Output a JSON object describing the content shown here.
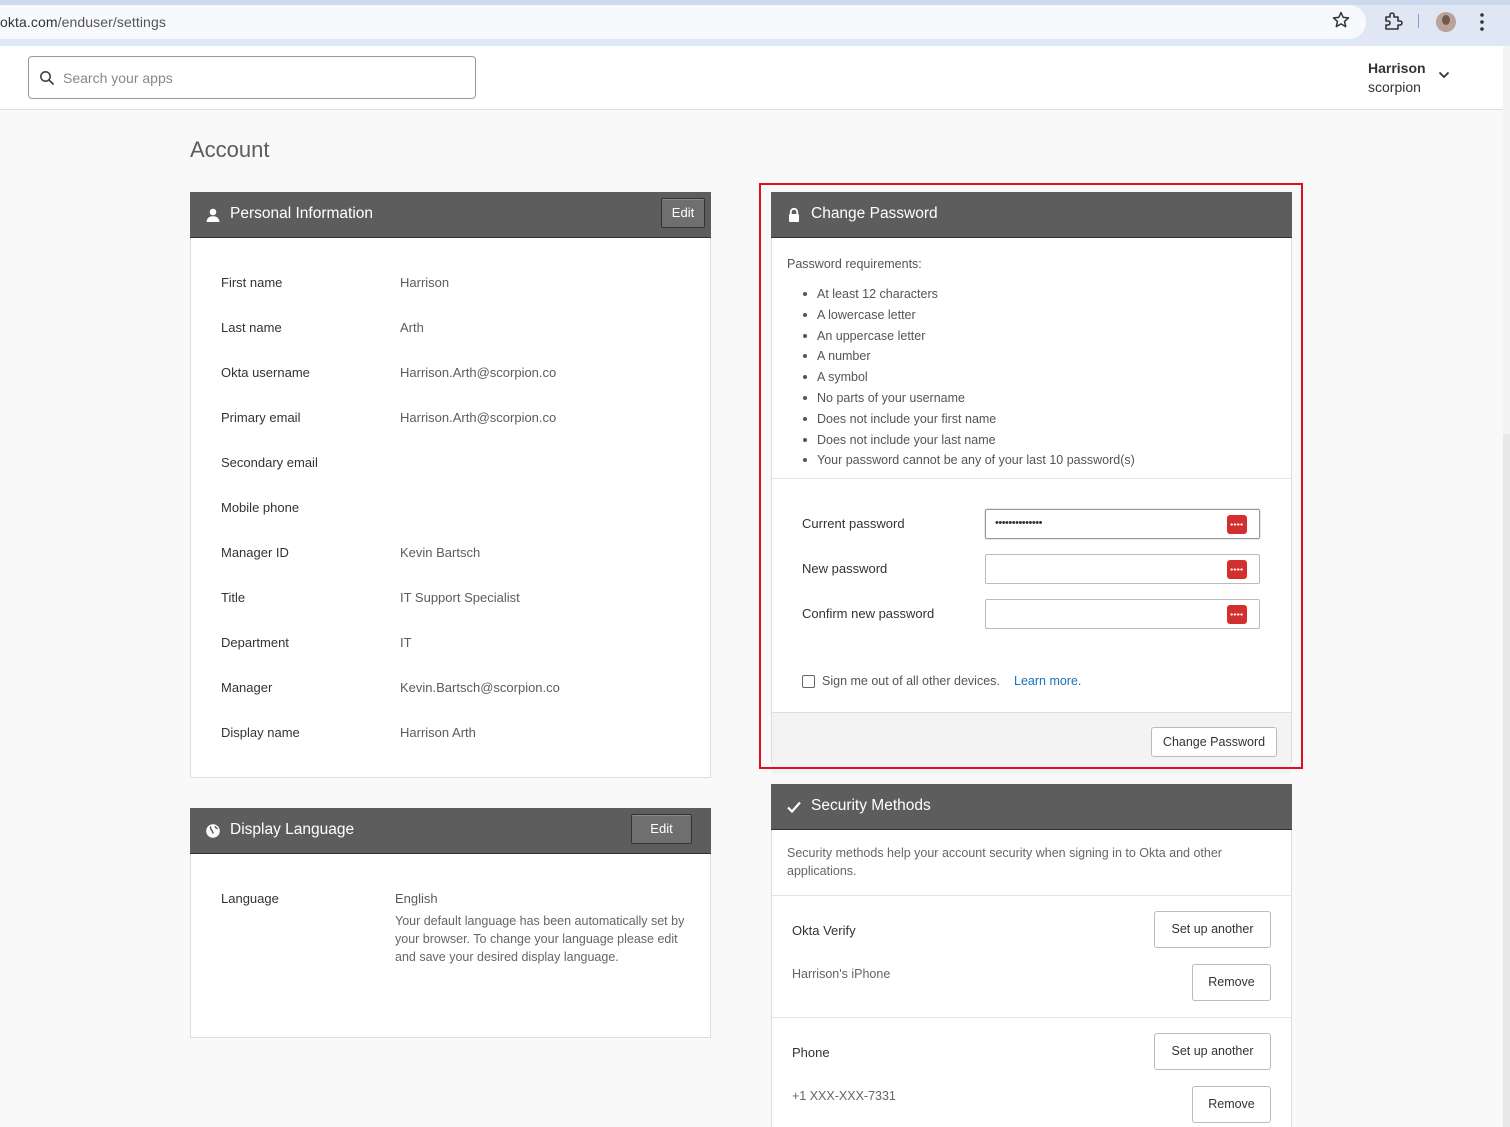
{
  "browser": {
    "url_domain": "okta.com",
    "url_path": "/enduser/settings"
  },
  "header": {
    "search_placeholder": "Search your apps",
    "user_name": "Harrison",
    "user_org": "scorpion"
  },
  "page": {
    "title": "Account"
  },
  "personal_info": {
    "title": "Personal Information",
    "edit_label": "Edit",
    "rows": [
      {
        "label": "First name",
        "value": "Harrison"
      },
      {
        "label": "Last name",
        "value": "Arth"
      },
      {
        "label": "Okta username",
        "value": "Harrison.Arth@scorpion.co"
      },
      {
        "label": "Primary email",
        "value": "Harrison.Arth@scorpion.co"
      },
      {
        "label": "Secondary email",
        "value": ""
      },
      {
        "label": "Mobile phone",
        "value": ""
      },
      {
        "label": "Manager ID",
        "value": "Kevin Bartsch"
      },
      {
        "label": "Title",
        "value": "IT Support Specialist"
      },
      {
        "label": "Department",
        "value": "IT"
      },
      {
        "label": "Manager",
        "value": "Kevin.Bartsch@scorpion.co"
      },
      {
        "label": "Display name",
        "value": "Harrison Arth"
      }
    ]
  },
  "display_language": {
    "title": "Display Language",
    "edit_label": "Edit",
    "language_label": "Language",
    "language_value": "English",
    "description": "Your default language has been automatically set by your browser. To change your language please edit and save your desired display language."
  },
  "change_password": {
    "title": "Change Password",
    "requirements_title": "Password requirements:",
    "requirements": [
      "At least 12 characters",
      "A lowercase letter",
      "An uppercase letter",
      "A number",
      "A symbol",
      "No parts of your username",
      "Does not include your first name",
      "Does not include your last name",
      "Your password cannot be any of your last 10 password(s)"
    ],
    "current_password_label": "Current password",
    "current_password_value": "••••••••••••••",
    "new_password_label": "New password",
    "confirm_password_label": "Confirm new password",
    "sign_out_label": "Sign me out of all other devices.",
    "learn_more": "Learn more.",
    "submit_label": "Change Password"
  },
  "security_methods": {
    "title": "Security Methods",
    "intro": "Security methods help your account security when signing in to Okta and other applications.",
    "methods": [
      {
        "name": "Okta Verify",
        "setup_label": "Set up another",
        "device": "Harrison's iPhone",
        "remove_label": "Remove"
      },
      {
        "name": "Phone",
        "setup_label": "Set up another",
        "device": "+1 XXX-XXX-7331",
        "remove_label": "Remove"
      }
    ]
  }
}
